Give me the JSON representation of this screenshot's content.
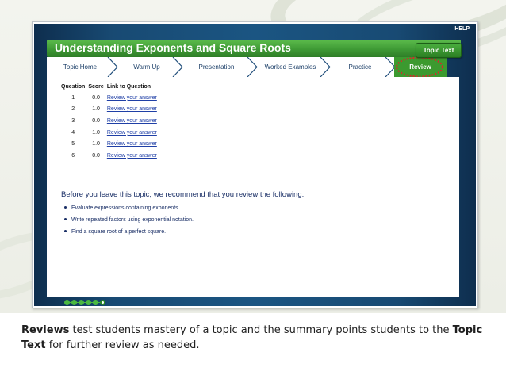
{
  "app": {
    "help_label": "HELP",
    "title": "Understanding Exponents and Square Roots",
    "topic_text_button": "Topic Text",
    "tabs": [
      {
        "label": "Topic Home"
      },
      {
        "label": "Warm Up"
      },
      {
        "label": "Presentation"
      },
      {
        "label": "Worked Examples"
      },
      {
        "label": "Practice"
      },
      {
        "label": "Review",
        "active": true
      }
    ]
  },
  "review_table": {
    "headers": [
      "Question",
      "Score",
      "Link to Question"
    ],
    "rows": [
      {
        "question": "1",
        "score": "0.0",
        "link": "Review your answer"
      },
      {
        "question": "2",
        "score": "1.0",
        "link": "Review your answer"
      },
      {
        "question": "3",
        "score": "0.0",
        "link": "Review your answer"
      },
      {
        "question": "4",
        "score": "1.0",
        "link": "Review your answer"
      },
      {
        "question": "5",
        "score": "1.0",
        "link": "Review your answer"
      },
      {
        "question": "6",
        "score": "0.0",
        "link": "Review your answer"
      }
    ]
  },
  "recommendation": {
    "intro": "Before you leave this topic, we recommend that you review the following:",
    "points": [
      "Evaluate expressions containing exponents.",
      "Write repeated factors using exponential notation.",
      "Find a square root of a perfect square."
    ]
  },
  "progress": {
    "total_steps": 6,
    "current_step": 6
  },
  "caption": {
    "bold1": "Reviews",
    "text1": " test students mastery of a topic and the summary points students to the ",
    "bold2": "Topic Text",
    "text2": " for further review as needed."
  },
  "colors": {
    "frame_blue": "#1b5582",
    "title_green": "#3f9a35",
    "active_tab": "#3c9a2f",
    "link_blue": "#1f3fa6",
    "highlight_red": "#d8262b"
  },
  "icons": {
    "tab_separator": "chevron-right-icon",
    "bullet": "bullet-dot-icon",
    "progress_dot": "progress-dot-icon",
    "highlight": "dotted-ellipse-highlight"
  }
}
